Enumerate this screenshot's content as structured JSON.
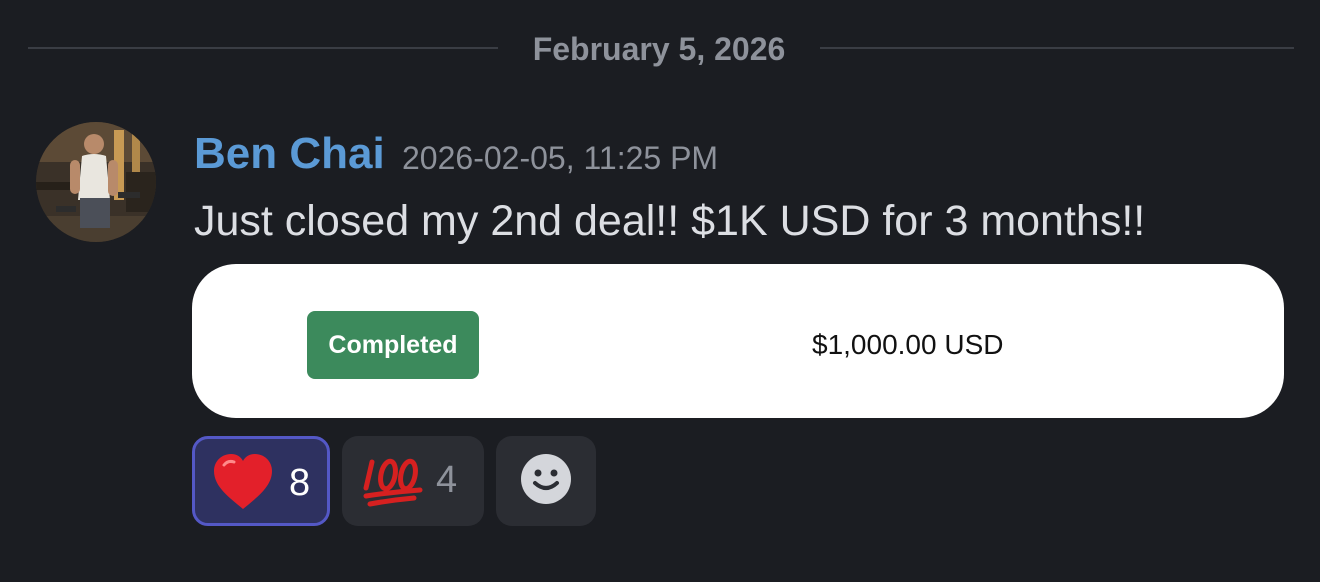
{
  "divider": {
    "date": "February 5, 2026"
  },
  "message": {
    "author": "Ben Chai",
    "timestamp": "2026-02-05, 11:25 PM",
    "text": "Just closed my 2nd deal!! $1K USD for 3 months!!",
    "avatar_icon": "user-avatar-photo"
  },
  "attachment": {
    "status": "Completed",
    "amount": "$1,000.00 USD",
    "status_color": "#3c8a5c"
  },
  "reactions": [
    {
      "emoji": "heart-emoji",
      "count": "8",
      "selected": true
    },
    {
      "emoji": "hundred-points-emoji",
      "count": "4",
      "selected": false
    }
  ],
  "add_reaction_icon": "smiley-add-reaction-icon",
  "colors": {
    "background": "#1b1d22",
    "username": "#5b9ad6",
    "selected_reaction_bg": "#2e3160",
    "selected_reaction_border": "#5458c6"
  }
}
